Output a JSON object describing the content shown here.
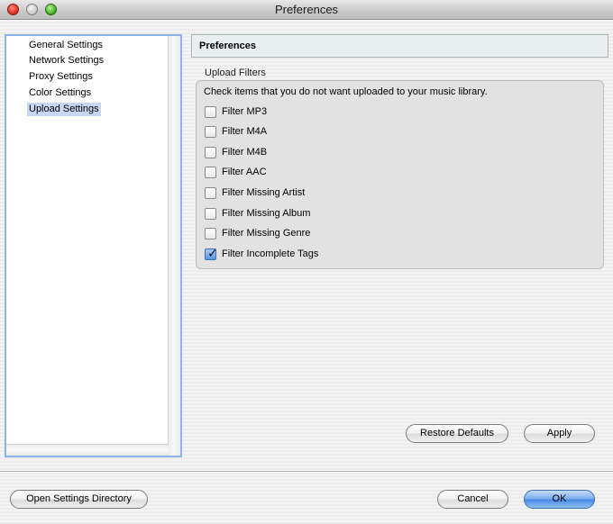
{
  "window": {
    "title": "Preferences"
  },
  "sidebar": {
    "items": [
      {
        "label": "General Settings",
        "selected": false
      },
      {
        "label": "Network Settings",
        "selected": false
      },
      {
        "label": "Proxy Settings",
        "selected": false
      },
      {
        "label": "Color Settings",
        "selected": false
      },
      {
        "label": "Upload Settings",
        "selected": true
      }
    ]
  },
  "panel": {
    "header": "Preferences",
    "group_title": "Upload Filters",
    "instructions": "Check items that you do not want uploaded to your music library.",
    "filters": [
      {
        "label": "Filter MP3",
        "checked": false
      },
      {
        "label": "Filter M4A",
        "checked": false
      },
      {
        "label": "Filter M4B",
        "checked": false
      },
      {
        "label": "Filter AAC",
        "checked": false
      },
      {
        "label": "Filter Missing Artist",
        "checked": false
      },
      {
        "label": "Filter Missing Album",
        "checked": false
      },
      {
        "label": "Filter Missing Genre",
        "checked": false
      },
      {
        "label": "Filter Incomplete Tags",
        "checked": true
      }
    ],
    "restore_label": "Restore Defaults",
    "apply_label": "Apply"
  },
  "footer": {
    "open_dir_label": "Open Settings Directory",
    "cancel_label": "Cancel",
    "ok_label": "OK"
  },
  "colors": {
    "selection": "#c5d7f3",
    "default_button": "#4a8ae2",
    "checkbox_checked": "#5d95e3"
  }
}
